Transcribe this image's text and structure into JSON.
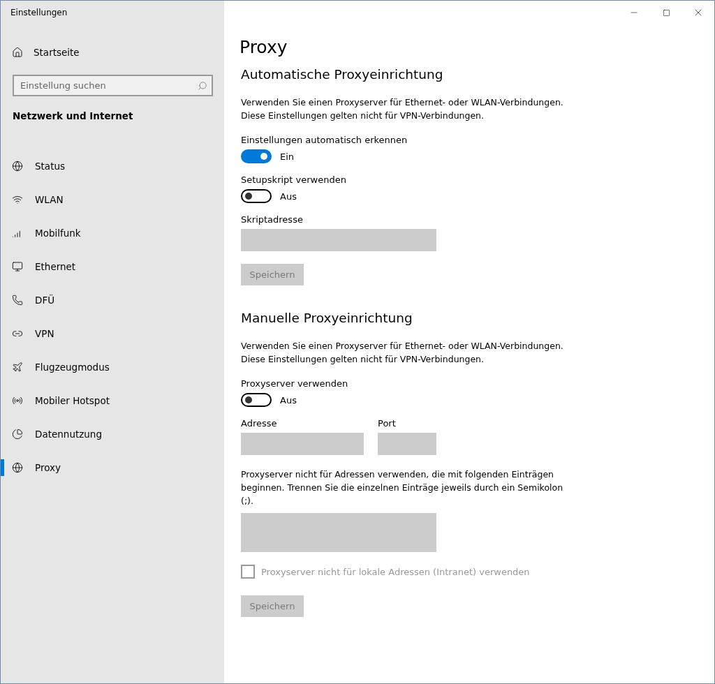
{
  "window": {
    "title": "Einstellungen"
  },
  "sidebar": {
    "home": "Startseite",
    "search": {
      "placeholder": "Einstellung suchen"
    },
    "section": "Netzwerk und Internet",
    "items": [
      {
        "label": "Status",
        "selected": false
      },
      {
        "label": "WLAN",
        "selected": false
      },
      {
        "label": "Mobilfunk",
        "selected": false
      },
      {
        "label": "Ethernet",
        "selected": false
      },
      {
        "label": "DFÜ",
        "selected": false
      },
      {
        "label": "VPN",
        "selected": false
      },
      {
        "label": "Flugzeugmodus",
        "selected": false
      },
      {
        "label": "Mobiler Hotspot",
        "selected": false
      },
      {
        "label": "Datennutzung",
        "selected": false
      },
      {
        "label": "Proxy",
        "selected": true
      }
    ]
  },
  "page": {
    "title": "Proxy",
    "sections": [
      {
        "heading": "Automatische Proxyeinrichtung",
        "description": "Verwenden Sie einen Proxyserver für Ethernet- oder WLAN-Verbindungen. Diese Einstellungen gelten nicht für VPN-Verbindungen.",
        "controls": [
          {
            "kind": "toggle",
            "label": "Einstellungen automatisch erkennen",
            "on": true,
            "state_text": "Ein"
          },
          {
            "kind": "toggle",
            "label": "Setupskript verwenden",
            "on": false,
            "state_text": "Aus"
          },
          {
            "kind": "field",
            "label": "Skriptadresse",
            "disabled": true
          },
          {
            "kind": "button",
            "label": "Speichern",
            "disabled": true
          }
        ]
      },
      {
        "heading": "Manuelle Proxyeinrichtung",
        "description": "Verwenden Sie einen Proxyserver für Ethernet- oder WLAN-Verbindungen. Diese Einstellungen gelten nicht für VPN-Verbindungen.",
        "controls": [
          {
            "kind": "toggle",
            "label": "Proxyserver verwenden",
            "on": false,
            "state_text": "Aus"
          },
          {
            "kind": "field-pair",
            "fields": [
              {
                "label": "Adresse",
                "disabled": true
              },
              {
                "label": "Port",
                "disabled": true
              }
            ]
          },
          {
            "kind": "textarea",
            "label": "Proxyserver nicht für Adressen verwenden, die mit folgenden Einträgen beginnen. Trennen Sie die einzelnen Einträge jeweils durch ein Semikolon (;).",
            "disabled": true
          },
          {
            "kind": "checkbox",
            "label": "Proxyserver nicht für lokale Adressen (Intranet) verwenden",
            "checked": false,
            "disabled": true
          },
          {
            "kind": "button",
            "label": "Speichern",
            "disabled": true
          }
        ]
      }
    ]
  }
}
